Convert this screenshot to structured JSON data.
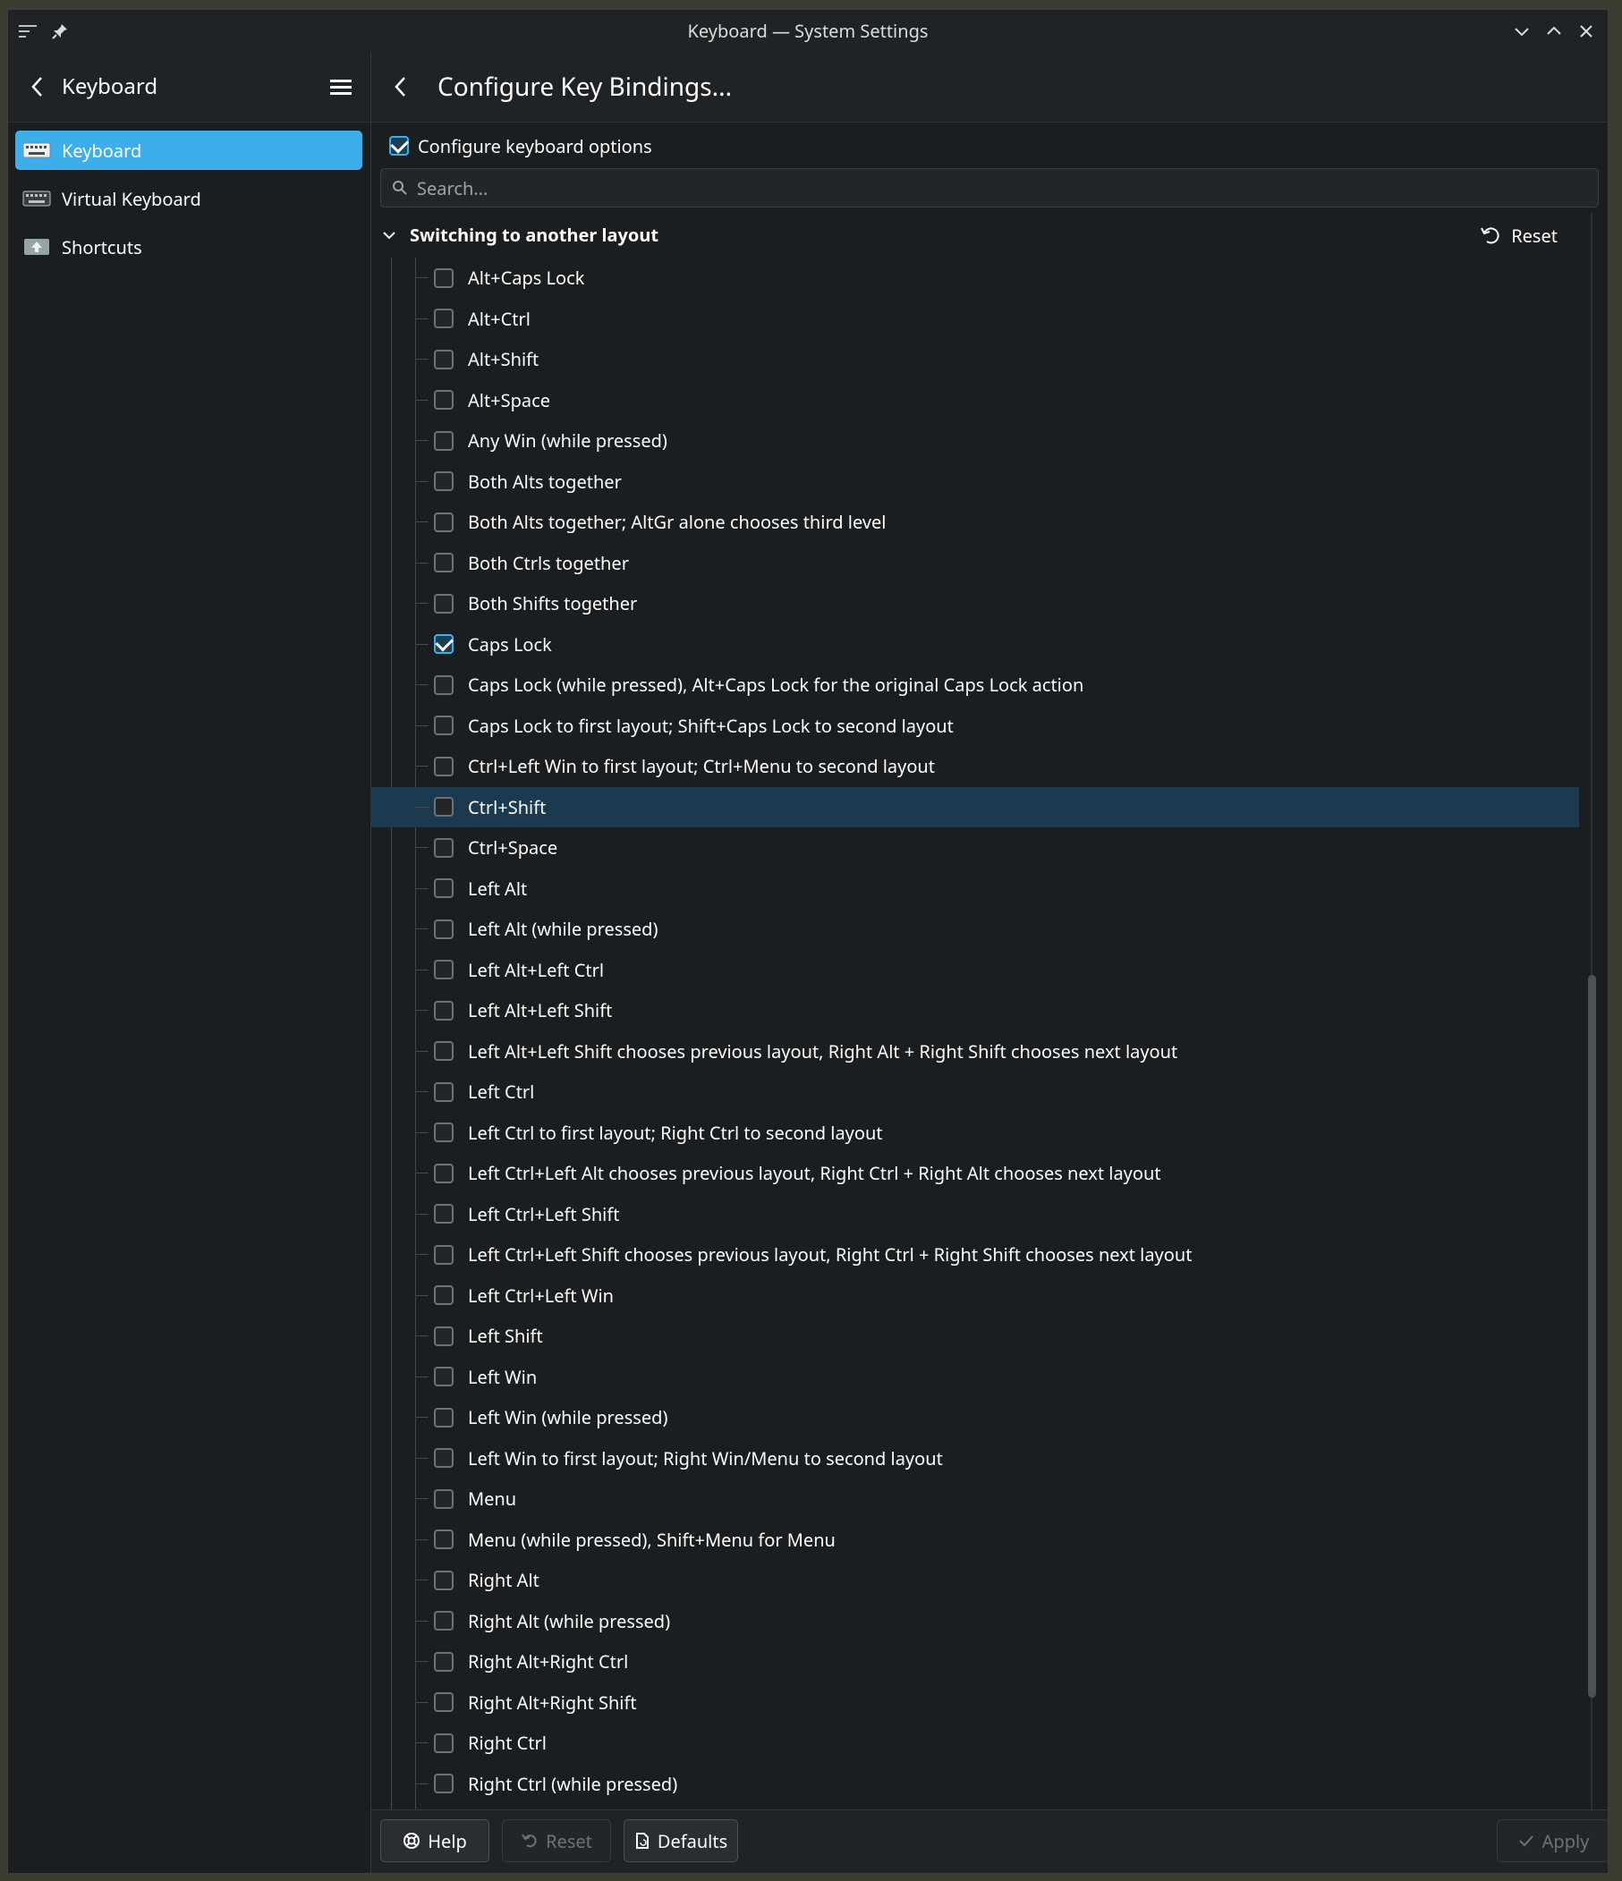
{
  "window": {
    "title": "Keyboard — System Settings"
  },
  "sidebar": {
    "title": "Keyboard",
    "items": [
      {
        "label": "Keyboard",
        "icon": "keyboard-icon",
        "active": true
      },
      {
        "label": "Virtual Keyboard",
        "icon": "virtual-keyboard-icon",
        "active": false
      },
      {
        "label": "Shortcuts",
        "icon": "shortcuts-icon",
        "active": false
      }
    ]
  },
  "main": {
    "title": "Configure Key Bindings...",
    "configure_label": "Configure keyboard options",
    "configure_checked": true,
    "search_placeholder": "Search...",
    "group": {
      "title": "Switching to another layout",
      "reset_label": "Reset",
      "items": [
        {
          "label": "Alt+Caps Lock",
          "checked": false
        },
        {
          "label": "Alt+Ctrl",
          "checked": false
        },
        {
          "label": "Alt+Shift",
          "checked": false
        },
        {
          "label": "Alt+Space",
          "checked": false
        },
        {
          "label": "Any Win (while pressed)",
          "checked": false
        },
        {
          "label": "Both Alts together",
          "checked": false
        },
        {
          "label": "Both Alts together; AltGr alone chooses third level",
          "checked": false
        },
        {
          "label": "Both Ctrls together",
          "checked": false
        },
        {
          "label": "Both Shifts together",
          "checked": false
        },
        {
          "label": "Caps Lock",
          "checked": true
        },
        {
          "label": "Caps Lock (while pressed), Alt+Caps Lock for the original Caps Lock action",
          "checked": false
        },
        {
          "label": "Caps Lock to first layout; Shift+Caps Lock to second layout",
          "checked": false
        },
        {
          "label": "Ctrl+Left Win to first layout; Ctrl+Menu to second layout",
          "checked": false
        },
        {
          "label": "Ctrl+Shift",
          "checked": false,
          "hover": true
        },
        {
          "label": "Ctrl+Space",
          "checked": false
        },
        {
          "label": "Left Alt",
          "checked": false
        },
        {
          "label": "Left Alt (while pressed)",
          "checked": false
        },
        {
          "label": "Left Alt+Left Ctrl",
          "checked": false
        },
        {
          "label": "Left Alt+Left Shift",
          "checked": false
        },
        {
          "label": "Left Alt+Left Shift chooses previous layout, Right Alt + Right Shift chooses next layout",
          "checked": false
        },
        {
          "label": "Left Ctrl",
          "checked": false
        },
        {
          "label": "Left Ctrl to first layout; Right Ctrl to second layout",
          "checked": false
        },
        {
          "label": "Left Ctrl+Left Alt chooses previous layout, Right Ctrl + Right Alt chooses next layout",
          "checked": false
        },
        {
          "label": "Left Ctrl+Left Shift",
          "checked": false
        },
        {
          "label": "Left Ctrl+Left Shift chooses previous layout, Right Ctrl + Right Shift chooses next layout",
          "checked": false
        },
        {
          "label": "Left Ctrl+Left Win",
          "checked": false
        },
        {
          "label": "Left Shift",
          "checked": false
        },
        {
          "label": "Left Win",
          "checked": false
        },
        {
          "label": "Left Win (while pressed)",
          "checked": false
        },
        {
          "label": "Left Win to first layout; Right Win/Menu to second layout",
          "checked": false
        },
        {
          "label": "Menu",
          "checked": false
        },
        {
          "label": "Menu (while pressed), Shift+Menu for Menu",
          "checked": false
        },
        {
          "label": "Right Alt",
          "checked": false
        },
        {
          "label": "Right Alt (while pressed)",
          "checked": false
        },
        {
          "label": "Right Alt+Right Ctrl",
          "checked": false
        },
        {
          "label": "Right Alt+Right Shift",
          "checked": false
        },
        {
          "label": "Right Ctrl",
          "checked": false
        },
        {
          "label": "Right Ctrl (while pressed)",
          "checked": false
        }
      ]
    }
  },
  "footer": {
    "help_label": "Help",
    "reset_label": "Reset",
    "defaults_label": "Defaults",
    "apply_label": "Apply"
  },
  "colors": {
    "accent": "#3daee9",
    "background": "#1b1e20",
    "hover_row": "#1c3a4f"
  }
}
